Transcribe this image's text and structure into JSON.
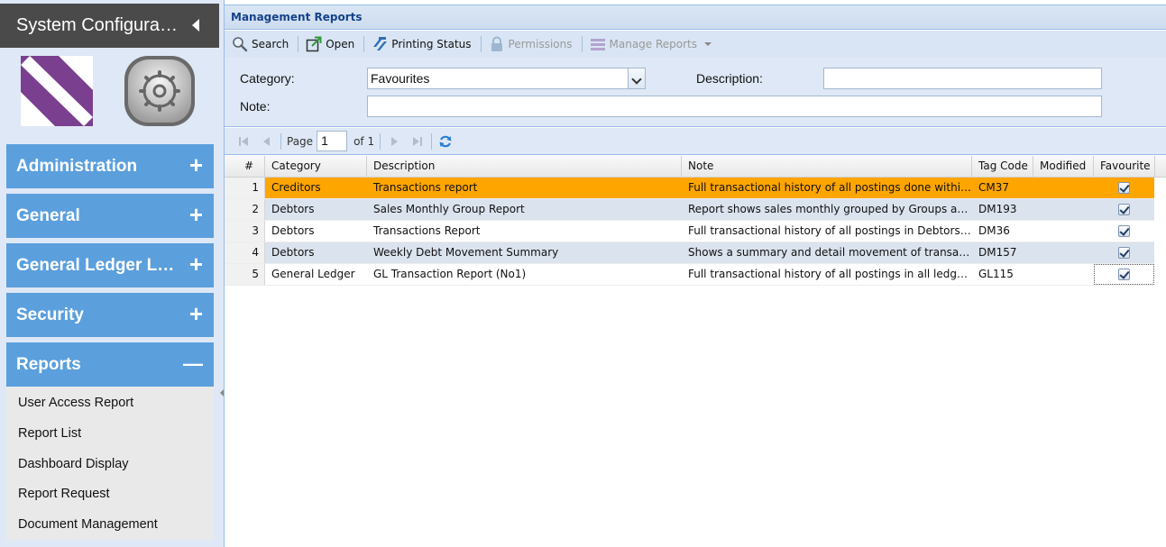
{
  "sidebar": {
    "title": "System Configurati…",
    "groups": [
      {
        "label": "Administration",
        "sign": "+"
      },
      {
        "label": "General",
        "sign": "+"
      },
      {
        "label": "General Ledger Lin…",
        "sign": "+"
      },
      {
        "label": "Security",
        "sign": "+"
      },
      {
        "label": "Reports",
        "sign": "—"
      }
    ],
    "report_items": [
      "User Access Report",
      "Report List",
      "Dashboard Display",
      "Report Request",
      "Document Management"
    ]
  },
  "panel": {
    "title": "Management Reports"
  },
  "toolbar": {
    "search": "Search",
    "open": "Open",
    "printing_status": "Printing Status",
    "permissions": "Permissions",
    "manage_reports": "Manage Reports"
  },
  "filter": {
    "category_label": "Category:",
    "category_value": "Favourites",
    "description_label": "Description:",
    "description_value": "",
    "note_label": "Note:",
    "note_value": ""
  },
  "pager": {
    "page_label": "Page",
    "page_value": "1",
    "of_label": "of 1"
  },
  "grid": {
    "columns": [
      "#",
      "Category",
      "Description",
      "Note",
      "Tag Code",
      "Modified",
      "Favourite"
    ],
    "rows": [
      {
        "num": "1",
        "category": "Creditors",
        "description": "Transactions report",
        "note": "Full transactional history of all postings done within Cr…",
        "tag": "CM37",
        "modified": "",
        "favourite": true
      },
      {
        "num": "2",
        "category": "Debtors",
        "description": "Sales Monthly Group Report",
        "note": "Report shows sales monthly grouped by Groups and t…",
        "tag": "DM193",
        "modified": "",
        "favourite": true
      },
      {
        "num": "3",
        "category": "Debtors",
        "description": "Transactions Report",
        "note": "Full transactional history of all postings in Debtors wit…",
        "tag": "DM36",
        "modified": "",
        "favourite": true
      },
      {
        "num": "4",
        "category": "Debtors",
        "description": "Weekly Debt Movement Summary",
        "note": "Shows a summary and detail movement of transaction…",
        "tag": "DM157",
        "modified": "",
        "favourite": true
      },
      {
        "num": "5",
        "category": "General Ledger",
        "description": "GL Transaction Report (No1)",
        "note": "Full transactional history of all postings in all ledger ac…",
        "tag": "GL115",
        "modified": "",
        "favourite": true
      }
    ]
  },
  "colors": {
    "accent": "#5b9fdd",
    "selected_row": "#ffa500",
    "header_dark": "#4a4a4a",
    "panel_title": "#15428b"
  }
}
